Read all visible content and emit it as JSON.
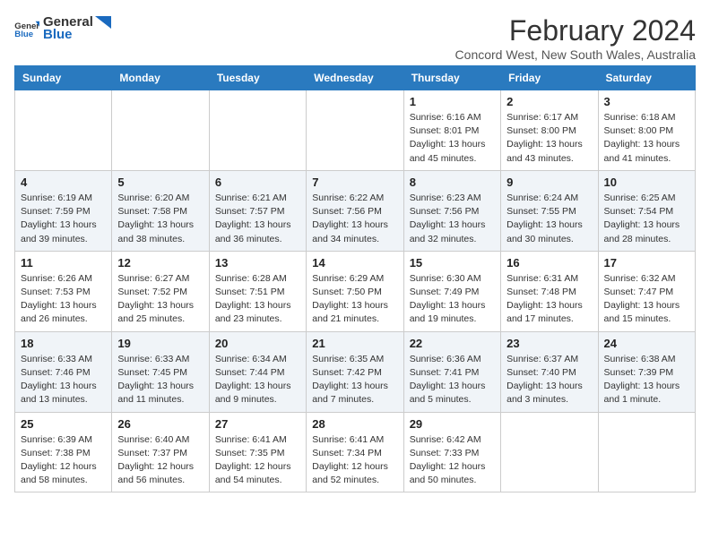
{
  "header": {
    "logo_general": "General",
    "logo_blue": "Blue",
    "month_title": "February 2024",
    "subtitle": "Concord West, New South Wales, Australia"
  },
  "days_of_week": [
    "Sunday",
    "Monday",
    "Tuesday",
    "Wednesday",
    "Thursday",
    "Friday",
    "Saturday"
  ],
  "weeks": [
    [
      {
        "day": "",
        "info": ""
      },
      {
        "day": "",
        "info": ""
      },
      {
        "day": "",
        "info": ""
      },
      {
        "day": "",
        "info": ""
      },
      {
        "day": "1",
        "info": "Sunrise: 6:16 AM\nSunset: 8:01 PM\nDaylight: 13 hours\nand 45 minutes."
      },
      {
        "day": "2",
        "info": "Sunrise: 6:17 AM\nSunset: 8:00 PM\nDaylight: 13 hours\nand 43 minutes."
      },
      {
        "day": "3",
        "info": "Sunrise: 6:18 AM\nSunset: 8:00 PM\nDaylight: 13 hours\nand 41 minutes."
      }
    ],
    [
      {
        "day": "4",
        "info": "Sunrise: 6:19 AM\nSunset: 7:59 PM\nDaylight: 13 hours\nand 39 minutes."
      },
      {
        "day": "5",
        "info": "Sunrise: 6:20 AM\nSunset: 7:58 PM\nDaylight: 13 hours\nand 38 minutes."
      },
      {
        "day": "6",
        "info": "Sunrise: 6:21 AM\nSunset: 7:57 PM\nDaylight: 13 hours\nand 36 minutes."
      },
      {
        "day": "7",
        "info": "Sunrise: 6:22 AM\nSunset: 7:56 PM\nDaylight: 13 hours\nand 34 minutes."
      },
      {
        "day": "8",
        "info": "Sunrise: 6:23 AM\nSunset: 7:56 PM\nDaylight: 13 hours\nand 32 minutes."
      },
      {
        "day": "9",
        "info": "Sunrise: 6:24 AM\nSunset: 7:55 PM\nDaylight: 13 hours\nand 30 minutes."
      },
      {
        "day": "10",
        "info": "Sunrise: 6:25 AM\nSunset: 7:54 PM\nDaylight: 13 hours\nand 28 minutes."
      }
    ],
    [
      {
        "day": "11",
        "info": "Sunrise: 6:26 AM\nSunset: 7:53 PM\nDaylight: 13 hours\nand 26 minutes."
      },
      {
        "day": "12",
        "info": "Sunrise: 6:27 AM\nSunset: 7:52 PM\nDaylight: 13 hours\nand 25 minutes."
      },
      {
        "day": "13",
        "info": "Sunrise: 6:28 AM\nSunset: 7:51 PM\nDaylight: 13 hours\nand 23 minutes."
      },
      {
        "day": "14",
        "info": "Sunrise: 6:29 AM\nSunset: 7:50 PM\nDaylight: 13 hours\nand 21 minutes."
      },
      {
        "day": "15",
        "info": "Sunrise: 6:30 AM\nSunset: 7:49 PM\nDaylight: 13 hours\nand 19 minutes."
      },
      {
        "day": "16",
        "info": "Sunrise: 6:31 AM\nSunset: 7:48 PM\nDaylight: 13 hours\nand 17 minutes."
      },
      {
        "day": "17",
        "info": "Sunrise: 6:32 AM\nSunset: 7:47 PM\nDaylight: 13 hours\nand 15 minutes."
      }
    ],
    [
      {
        "day": "18",
        "info": "Sunrise: 6:33 AM\nSunset: 7:46 PM\nDaylight: 13 hours\nand 13 minutes."
      },
      {
        "day": "19",
        "info": "Sunrise: 6:33 AM\nSunset: 7:45 PM\nDaylight: 13 hours\nand 11 minutes."
      },
      {
        "day": "20",
        "info": "Sunrise: 6:34 AM\nSunset: 7:44 PM\nDaylight: 13 hours\nand 9 minutes."
      },
      {
        "day": "21",
        "info": "Sunrise: 6:35 AM\nSunset: 7:42 PM\nDaylight: 13 hours\nand 7 minutes."
      },
      {
        "day": "22",
        "info": "Sunrise: 6:36 AM\nSunset: 7:41 PM\nDaylight: 13 hours\nand 5 minutes."
      },
      {
        "day": "23",
        "info": "Sunrise: 6:37 AM\nSunset: 7:40 PM\nDaylight: 13 hours\nand 3 minutes."
      },
      {
        "day": "24",
        "info": "Sunrise: 6:38 AM\nSunset: 7:39 PM\nDaylight: 13 hours\nand 1 minute."
      }
    ],
    [
      {
        "day": "25",
        "info": "Sunrise: 6:39 AM\nSunset: 7:38 PM\nDaylight: 12 hours\nand 58 minutes."
      },
      {
        "day": "26",
        "info": "Sunrise: 6:40 AM\nSunset: 7:37 PM\nDaylight: 12 hours\nand 56 minutes."
      },
      {
        "day": "27",
        "info": "Sunrise: 6:41 AM\nSunset: 7:35 PM\nDaylight: 12 hours\nand 54 minutes."
      },
      {
        "day": "28",
        "info": "Sunrise: 6:41 AM\nSunset: 7:34 PM\nDaylight: 12 hours\nand 52 minutes."
      },
      {
        "day": "29",
        "info": "Sunrise: 6:42 AM\nSunset: 7:33 PM\nDaylight: 12 hours\nand 50 minutes."
      },
      {
        "day": "",
        "info": ""
      },
      {
        "day": "",
        "info": ""
      }
    ]
  ]
}
